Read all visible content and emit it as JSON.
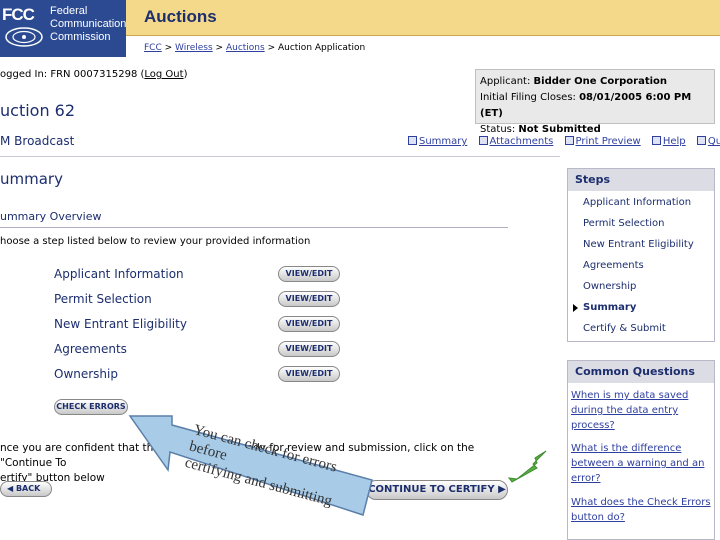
{
  "header": {
    "logo_mark": "FCC",
    "logo_text_1": "Federal",
    "logo_text_2": "Communications",
    "logo_text_3": "Commission",
    "section_title": "Auctions",
    "breadcrumb": [
      "FCC",
      "Wireless",
      "Auctions",
      "Auction Application"
    ]
  },
  "session": {
    "logged_in": "ogged In: FRN 0007315298 (",
    "logout": "Log Out",
    "logged_end": ")"
  },
  "applicant": {
    "applicant_label": "Applicant:",
    "applicant_value": "Bidder One Corporation",
    "filing_label": "Initial Filing Closes:",
    "filing_value": "08/01/2005 6:00 PM (ET)",
    "status_label": "Status:",
    "status_value": "Not Submitted"
  },
  "auction": {
    "title": "uction 62",
    "service": "M Broadcast"
  },
  "toplinks": [
    "Summary",
    "Attachments",
    "Print Preview",
    "Help",
    "Quit"
  ],
  "page": {
    "title": "ummary",
    "overview": "ummary Overview",
    "instructions": "hoose a step listed below to review your provided information",
    "steps": [
      {
        "label": "Applicant Information",
        "button": "VIEW/EDIT"
      },
      {
        "label": "Permit Selection",
        "button": "VIEW/EDIT"
      },
      {
        "label": "New Entrant Eligibility",
        "button": "VIEW/EDIT"
      },
      {
        "label": "Agreements",
        "button": "VIEW/EDIT"
      },
      {
        "label": "Ownership",
        "button": "VIEW/EDIT"
      }
    ],
    "check_errors": "CHECK ERRORS",
    "confident_1": "nce you are confident that the application is ready for review and submission, click on the \"Continue To",
    "confident_2": "ertify\" button below",
    "back": "BACK",
    "continue": "CONTINUE TO CERTIFY"
  },
  "sidebar_steps": {
    "title": "Steps",
    "items": [
      "Applicant Information",
      "Permit Selection",
      "New Entrant Eligibility",
      "Agreements",
      "Ownership",
      "Summary",
      "Certify & Submit"
    ],
    "current": "Summary"
  },
  "common_questions": {
    "title": "Common Questions",
    "items": [
      "When is my data saved during the data entry process?",
      "What is the difference between a warning and an error?",
      "What does the Check Errors button do?"
    ]
  },
  "annotation": {
    "text": "You can check for errors\nbefore\ncertifying and submitting"
  },
  "colors": {
    "fcc_blue": "#2b4a91",
    "title_bar": "#f5d98a",
    "heading": "#1c2e6e",
    "link": "#2f3f9f",
    "callout_arrow": "#a8cce8",
    "green_arrow": "#55b041"
  }
}
